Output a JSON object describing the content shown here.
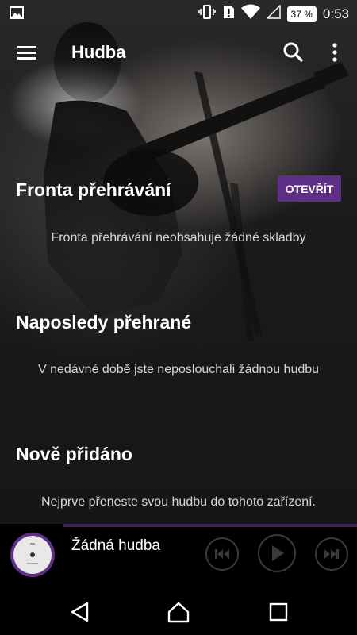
{
  "status_bar": {
    "battery": "37 %",
    "time": "0:53"
  },
  "app_bar": {
    "title": "Hudba"
  },
  "queue_section": {
    "title": "Fronta přehrávání",
    "open_label": "OTEVŘÍT",
    "empty_message": "Fronta přehrávání neobsahuje žádné skladby"
  },
  "recent_section": {
    "title": "Naposledy přehrané",
    "empty_message": "V nedávné době jste neposlouchali žádnou hudbu"
  },
  "new_section": {
    "title": "Nově přidáno",
    "empty_message": "Nejprve přeneste svou hudbu do tohoto zařízení."
  },
  "now_playing": {
    "title": "Žádná hudba"
  },
  "colors": {
    "accent": "#5e2f86",
    "background": "#161517"
  },
  "icons": [
    "image-icon",
    "vibrate-icon",
    "sim-alert-icon",
    "wifi-icon",
    "signal-icon",
    "battery-icon",
    "menu-icon",
    "search-icon",
    "more-vert-icon",
    "disc-icon",
    "skip-previous-icon",
    "play-icon",
    "skip-next-icon",
    "nav-back-icon",
    "nav-home-icon",
    "nav-recents-icon"
  ]
}
